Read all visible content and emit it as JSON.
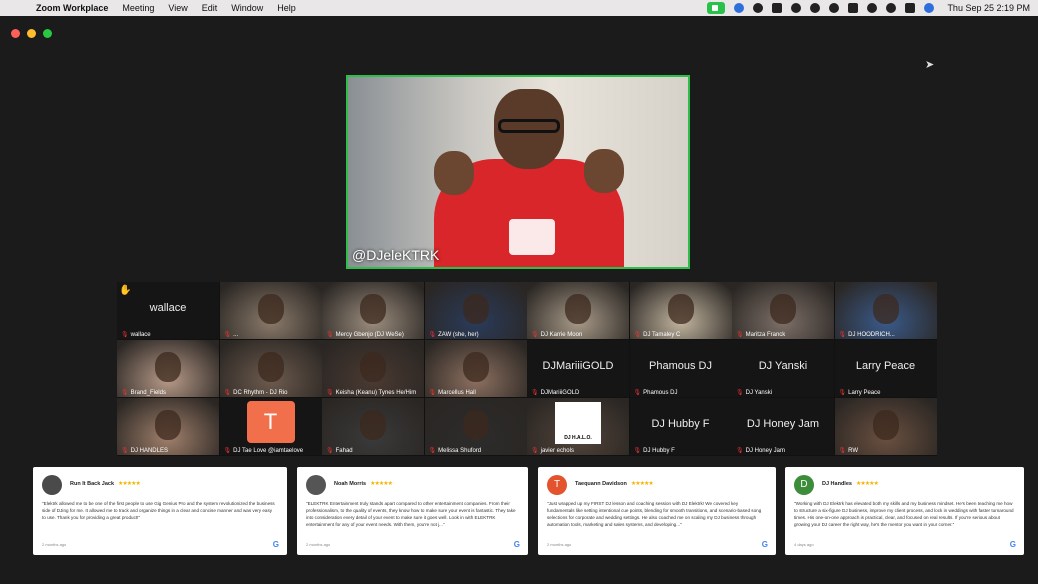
{
  "menubar": {
    "app": "Zoom Workplace",
    "items": [
      "Meeting",
      "View",
      "Edit",
      "Window",
      "Help"
    ],
    "clock": "Thu Sep 25  2:19 PM"
  },
  "speaker": {
    "name": "@DJeleKTRK"
  },
  "participants": [
    {
      "name": "wallace",
      "big": "wallace",
      "hand": true
    },
    {
      "name": "...",
      "video": true
    },
    {
      "name": "Mercy Gbenjo (DJ WeSe)",
      "video": true
    },
    {
      "name": "ZAW (she, her)",
      "video": true
    },
    {
      "name": "DJ Karrie Moon",
      "video": true
    },
    {
      "name": "DJ Tamaley C",
      "video": true
    },
    {
      "name": "Maritza Franck",
      "video": true
    },
    {
      "name": "DJ HOODRICH...",
      "video": true
    },
    {
      "name": "Brand_Fields",
      "video": true
    },
    {
      "name": "DC Rhythm - DJ Rio",
      "video": true
    },
    {
      "name": "Keisha (Keanu) Tynes He/Him",
      "video": true
    },
    {
      "name": "Marcellus Hall",
      "video": true
    },
    {
      "name": "DJMariiiGOLD",
      "big": "DJMariiiGOLD"
    },
    {
      "name": "Phamous DJ",
      "big": "Phamous DJ"
    },
    {
      "name": "DJ Yanski",
      "big": "DJ Yanski"
    },
    {
      "name": "Larry Peace",
      "big": "Larry Peace"
    },
    {
      "name": "DJ HANDLES",
      "video": true
    },
    {
      "name": "DJ Tae Love @iamtaelove",
      "avatar": "T"
    },
    {
      "name": "Fahad",
      "video": true
    },
    {
      "name": "Melissa Shuford",
      "video": true
    },
    {
      "name": "javier echols",
      "video": true,
      "logo": "DJ H.A.L.O."
    },
    {
      "name": "DJ Hubby F",
      "big": "DJ Hubby F"
    },
    {
      "name": "DJ Honey Jam",
      "big": "DJ Honey Jam"
    },
    {
      "name": "RW",
      "video": true
    }
  ],
  "reviews": [
    {
      "name": "Run It Back Jack",
      "stars": "★★★★★",
      "initial": "",
      "text": "\"Elektrk allowed me to be one of the first people to use Gig Genius Pro and the system revolutionized the business side of DJing for me. It allowed me to track and organize things in a clear and concise manner and was very easy to use. Thank you for providing a great product!\"",
      "when": "2 months ago"
    },
    {
      "name": "Noah Morris",
      "stars": "★★★★★",
      "initial": "",
      "text": "\"ELEKTRK Entertainment truly stands apart compared to other entertainment companies. From their professionalism, to the quality of events, they know how to make sure your event is fantastic. They take into consideration every detail of your event to make sure it goes well. Look in with ELEKTRK entertainment for any of your event needs. With them, you're not j...\"",
      "when": "2 months ago"
    },
    {
      "name": "Taequann Davidson",
      "stars": "★★★★★",
      "initial": "T",
      "text": "\"Just wrapped up my FIRST DJ lesson and coaching session with DJ Elektrk! We covered key fundamentals like setting intentional cue points, blending for smooth transitions, and scenario-based song selections for corporate and wedding settings. He also coached me on scaling my DJ business through automation tools, marketing and sales systems, and developing...\"",
      "when": "2 months ago"
    },
    {
      "name": "DJ Handles",
      "stars": "★★★★★",
      "initial": "D",
      "text": "\"Working with DJ Elektrk has elevated both my skills and my business mindset. He's been teaching me how to structure a six-figure DJ business, improve my client process, and lock in weddings with faster turnaround times. His one-on-one approach is practical, clear, and focused on real results. If you're serious about growing your DJ career the right way, he's the mentor you want in your corner.\"",
      "when": "4 days ago"
    }
  ],
  "colors": {
    "speaker_border": "#2ebf4a",
    "star": "#f5b400",
    "muted_mic": "#e33333"
  }
}
